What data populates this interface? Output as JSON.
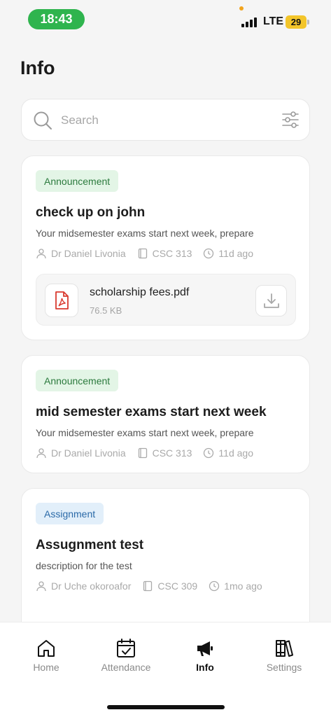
{
  "status_bar": {
    "time": "18:43",
    "network": "LTE",
    "battery": "29"
  },
  "page": {
    "title": "Info"
  },
  "search": {
    "placeholder": "Search"
  },
  "posts": [
    {
      "badge": "Announcement",
      "badge_type": "announcement",
      "title": "check up on john",
      "description": "Your midsemester exams start next week, prepare",
      "author": "Dr Daniel Livonia",
      "course": "CSC 313",
      "time": "11d ago",
      "attachment": {
        "name": "scholarship fees.pdf",
        "size": "76.5 KB"
      }
    },
    {
      "badge": "Announcement",
      "badge_type": "announcement",
      "title": "mid semester exams start next week",
      "description": "Your midsemester exams start next week, prepare",
      "author": "Dr Daniel Livonia",
      "course": "CSC 313",
      "time": "11d ago"
    },
    {
      "badge": "Assignment",
      "badge_type": "assignment",
      "title": "Assugnment test",
      "description": "description for the test",
      "author": "Dr Uche okoroafor",
      "course": "CSC 309",
      "time": "1mo ago"
    }
  ],
  "nav": {
    "items": [
      {
        "label": "Home",
        "icon": "home-icon"
      },
      {
        "label": "Attendance",
        "icon": "calendar-check-icon"
      },
      {
        "label": "Info",
        "icon": "megaphone-icon",
        "active": true
      },
      {
        "label": "Settings",
        "icon": "books-icon"
      }
    ]
  },
  "colors": {
    "announcement_bg": "#e3f5e6",
    "assignment_bg": "#e2effa",
    "time_pill": "#2fb44e",
    "battery": "#f3c52a"
  }
}
